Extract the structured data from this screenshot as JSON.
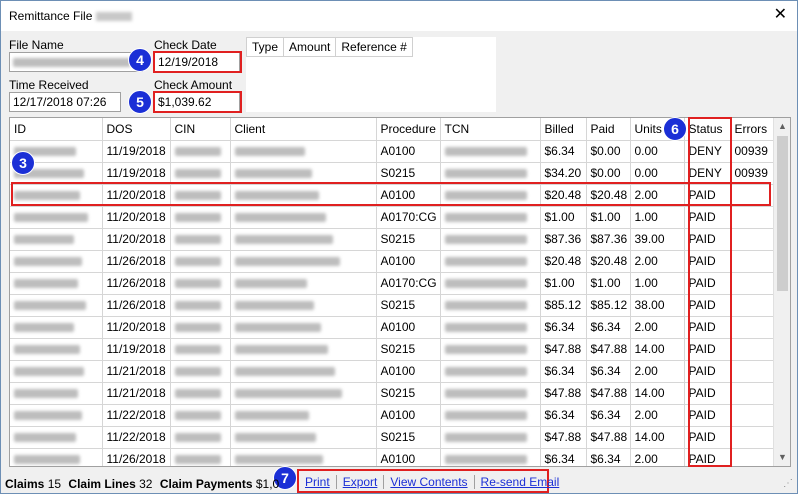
{
  "window": {
    "title": "Remittance File",
    "close_glyph": "✕"
  },
  "form": {
    "file_name_label": "File Name",
    "check_date_label": "Check Date",
    "check_date_value": "12/19/2018",
    "time_received_label": "Time Received",
    "time_received_value": "12/17/2018 07:26",
    "check_amount_label": "Check Amount",
    "check_amount_value": "$1,039.62"
  },
  "mini_grid": {
    "columns": [
      "Type",
      "Amount",
      "Reference #"
    ]
  },
  "grid": {
    "columns": [
      "ID",
      "DOS",
      "CIN",
      "Client",
      "Procedure",
      "TCN",
      "Billed",
      "Paid",
      "Units",
      "Status",
      "Errors"
    ],
    "rows": [
      {
        "dos": "11/19/2018",
        "procedure": "A0100",
        "billed": "$6.34",
        "paid": "$0.00",
        "units": "0.00",
        "status": "DENY",
        "errors": "00939"
      },
      {
        "dos": "11/19/2018",
        "procedure": "S0215",
        "billed": "$34.20",
        "paid": "$0.00",
        "units": "0.00",
        "status": "DENY",
        "errors": "00939"
      },
      {
        "dos": "11/20/2018",
        "procedure": "A0100",
        "billed": "$20.48",
        "paid": "$20.48",
        "units": "2.00",
        "status": "PAID",
        "errors": ""
      },
      {
        "dos": "11/20/2018",
        "procedure": "A0170:CG",
        "billed": "$1.00",
        "paid": "$1.00",
        "units": "1.00",
        "status": "PAID",
        "errors": ""
      },
      {
        "dos": "11/20/2018",
        "procedure": "S0215",
        "billed": "$87.36",
        "paid": "$87.36",
        "units": "39.00",
        "status": "PAID",
        "errors": ""
      },
      {
        "dos": "11/26/2018",
        "procedure": "A0100",
        "billed": "$20.48",
        "paid": "$20.48",
        "units": "2.00",
        "status": "PAID",
        "errors": ""
      },
      {
        "dos": "11/26/2018",
        "procedure": "A0170:CG",
        "billed": "$1.00",
        "paid": "$1.00",
        "units": "1.00",
        "status": "PAID",
        "errors": ""
      },
      {
        "dos": "11/26/2018",
        "procedure": "S0215",
        "billed": "$85.12",
        "paid": "$85.12",
        "units": "38.00",
        "status": "PAID",
        "errors": ""
      },
      {
        "dos": "11/20/2018",
        "procedure": "A0100",
        "billed": "$6.34",
        "paid": "$6.34",
        "units": "2.00",
        "status": "PAID",
        "errors": ""
      },
      {
        "dos": "11/19/2018",
        "procedure": "S0215",
        "billed": "$47.88",
        "paid": "$47.88",
        "units": "14.00",
        "status": "PAID",
        "errors": ""
      },
      {
        "dos": "11/21/2018",
        "procedure": "A0100",
        "billed": "$6.34",
        "paid": "$6.34",
        "units": "2.00",
        "status": "PAID",
        "errors": ""
      },
      {
        "dos": "11/21/2018",
        "procedure": "S0215",
        "billed": "$47.88",
        "paid": "$47.88",
        "units": "14.00",
        "status": "PAID",
        "errors": ""
      },
      {
        "dos": "11/22/2018",
        "procedure": "A0100",
        "billed": "$6.34",
        "paid": "$6.34",
        "units": "2.00",
        "status": "PAID",
        "errors": ""
      },
      {
        "dos": "11/22/2018",
        "procedure": "S0215",
        "billed": "$47.88",
        "paid": "$47.88",
        "units": "14.00",
        "status": "PAID",
        "errors": ""
      },
      {
        "dos": "11/26/2018",
        "procedure": "A0100",
        "billed": "$6.34",
        "paid": "$6.34",
        "units": "2.00",
        "status": "PAID",
        "errors": ""
      }
    ]
  },
  "status_bar": {
    "claims_label": "Claims",
    "claims_value": "15",
    "claim_lines_label": "Claim Lines",
    "claim_lines_value": "32",
    "claim_payments_label": "Claim Payments",
    "claim_payments_value": "$1,0"
  },
  "links": {
    "print": "Print",
    "export": "Export",
    "view_contents": "View Contents",
    "resend_email": "Re-send Email"
  },
  "callouts": {
    "b3": "3",
    "b4": "4",
    "b5": "5",
    "b6": "6",
    "b7": "7"
  },
  "colors": {
    "callout_blue": "#1b2fd6",
    "highlight_red": "#e02020",
    "link_blue": "#1b2fd6"
  }
}
